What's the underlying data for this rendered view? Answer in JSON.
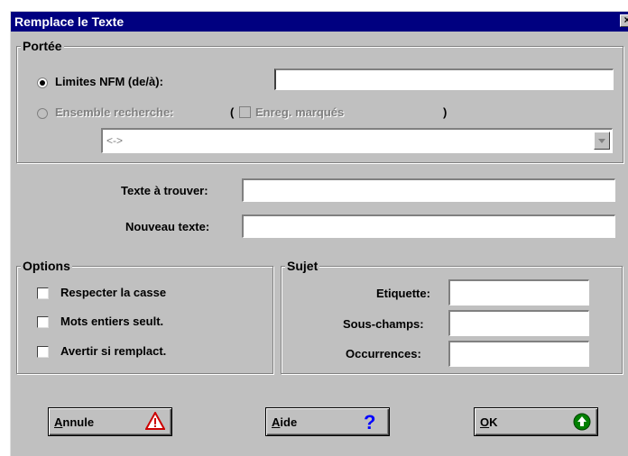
{
  "window": {
    "title": "Remplace le Texte",
    "close_glyph": "×"
  },
  "portee": {
    "legend": "Portée",
    "radio_limites": {
      "label": "Limites NFM (de/à):",
      "selected": true
    },
    "limites_value": "",
    "radio_ensemble": {
      "label": "Ensemble recherche:",
      "selected": false
    },
    "paren_open": "(",
    "enreg_checkbox": {
      "label": "Enreg. marqués",
      "checked": false
    },
    "paren_close": ")",
    "combo_value": "<->"
  },
  "fields": {
    "texte_label": "Texte à trouver:",
    "texte_value": "",
    "nouveau_label": "Nouveau texte:",
    "nouveau_value": ""
  },
  "options": {
    "legend": "Options",
    "items": [
      {
        "label": "Respecter la casse",
        "checked": false
      },
      {
        "label": "Mots entiers seult.",
        "checked": false
      },
      {
        "label": "Avertir si remplact.",
        "checked": false
      }
    ]
  },
  "sujet": {
    "legend": "Sujet",
    "etiquette_label": "Etiquette:",
    "souschamps_label": "Sous-champs:",
    "occurrences_label": "Occurrences:"
  },
  "buttons": {
    "annule": {
      "accel": "A",
      "rest": "nnule",
      "icon": "warning-icon"
    },
    "aide": {
      "accel": "A",
      "rest": "ide",
      "icon": "help-icon"
    },
    "ok": {
      "accel": "O",
      "rest": "K",
      "icon": "go-up-icon"
    }
  },
  "colors": {
    "titlebar": "#000080",
    "face": "#c0c0c0",
    "warning": "#cc0000",
    "help": "#0000ff",
    "ok": "#008000"
  }
}
